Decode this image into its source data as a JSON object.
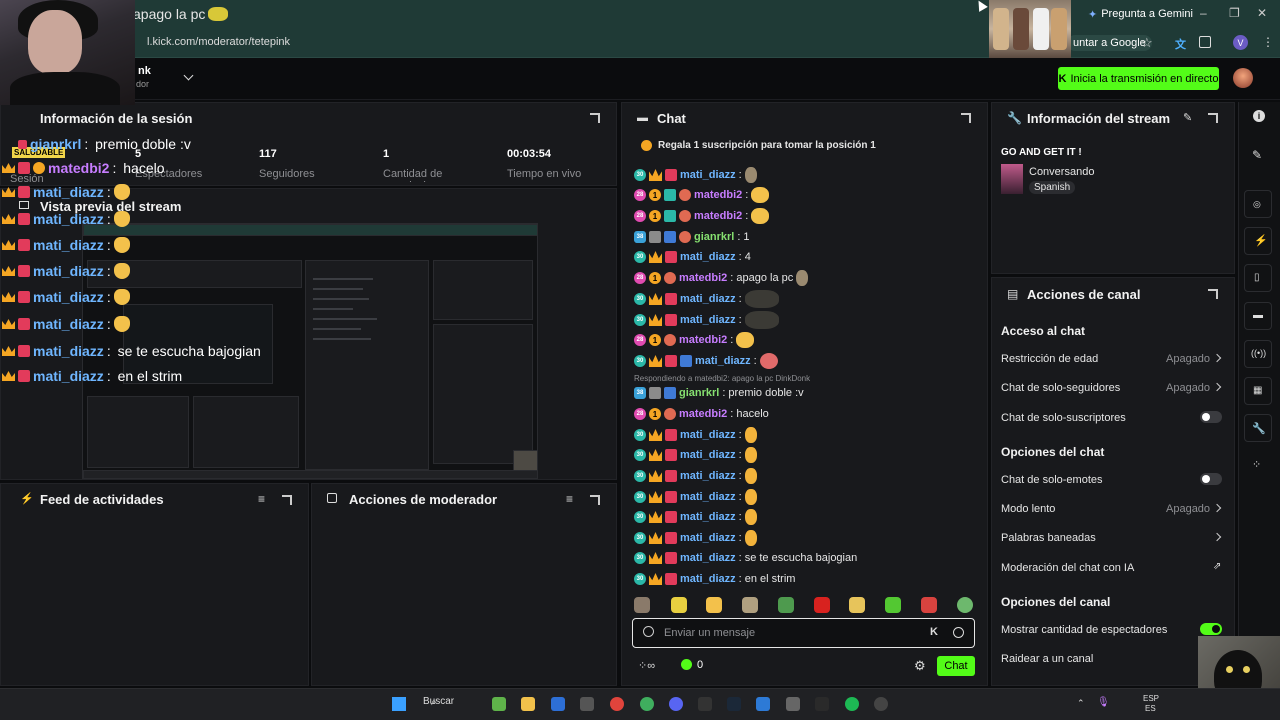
{
  "browser": {
    "tab_title": "apago la pc",
    "url": "l.kick.com/moderator/tetepink",
    "gemini_label": "Pregunta a Gemini",
    "google_btn": "untar a Google",
    "profile_initial": "V"
  },
  "kick": {
    "channel_short": "nk",
    "channel_sub": "dor",
    "live_button": "Inicia la transmisión en directo"
  },
  "session": {
    "title": "Información de la sesión",
    "session_label": "Sesión",
    "stats": [
      {
        "value": "5",
        "label": "Espectadores"
      },
      {
        "value": "117",
        "label": "Seguidores"
      },
      {
        "value": "1",
        "label": "Cantidad de suscripciones"
      },
      {
        "value": "00:03:54",
        "label": "Tiempo en vivo"
      }
    ]
  },
  "preview": {
    "title": "Vista previa del stream"
  },
  "overlay": {
    "badge": "SALUDABLE",
    "lines": [
      {
        "name": "gianrkrl",
        "msg": "premio doble :v",
        "style": "blue"
      },
      {
        "name": "matedbi2",
        "msg": "hacelo",
        "style": "purple"
      },
      {
        "name": "mati_diazz",
        "msg": "",
        "style": "blue"
      },
      {
        "name": "mati_diazz",
        "msg": "",
        "style": "blue"
      },
      {
        "name": "mati_diazz",
        "msg": "",
        "style": "blue"
      },
      {
        "name": "mati_diazz",
        "msg": "",
        "style": "blue"
      },
      {
        "name": "mati_diazz",
        "msg": "",
        "style": "blue"
      },
      {
        "name": "mati_diazz",
        "msg": "",
        "style": "blue"
      },
      {
        "name": "mati_diazz",
        "msg": "se te escucha bajogian",
        "style": "blue"
      },
      {
        "name": "mati_diazz",
        "msg": "en el strim",
        "style": "blue"
      }
    ]
  },
  "activity": {
    "title": "Feed de actividades"
  },
  "mod_actions": {
    "title": "Acciones de moderador"
  },
  "chat": {
    "title": "Chat",
    "pinned": "Regala 1 suscripción para tomar la posición 1",
    "reply_note": "Respondiendo a matedbi2: apago la pc DinkDonk",
    "messages": [
      {
        "name": "mati_diazz",
        "msg": "",
        "color": "blue"
      },
      {
        "name": "matedbi2",
        "msg": "",
        "color": "purple"
      },
      {
        "name": "matedbi2",
        "msg": "",
        "color": "purple"
      },
      {
        "name": "gianrkrl",
        "msg": "1",
        "color": "green"
      },
      {
        "name": "mati_diazz",
        "msg": "4",
        "color": "blue"
      },
      {
        "name": "matedbi2",
        "msg": "apago la pc",
        "color": "purple"
      },
      {
        "name": "mati_diazz",
        "msg": "",
        "color": "blue"
      },
      {
        "name": "mati_diazz",
        "msg": "",
        "color": "blue"
      },
      {
        "name": "matedbi2",
        "msg": "",
        "color": "purple"
      },
      {
        "name": "mati_diazz",
        "msg": "",
        "color": "blue"
      },
      {
        "name": "gianrkrl",
        "msg": "premio doble :v",
        "color": "green"
      },
      {
        "name": "matedbi2",
        "msg": "hacelo",
        "color": "purple"
      },
      {
        "name": "mati_diazz",
        "msg": "",
        "color": "blue"
      },
      {
        "name": "mati_diazz",
        "msg": "",
        "color": "blue"
      },
      {
        "name": "mati_diazz",
        "msg": "",
        "color": "blue"
      },
      {
        "name": "mati_diazz",
        "msg": "",
        "color": "blue"
      },
      {
        "name": "mati_diazz",
        "msg": "",
        "color": "blue"
      },
      {
        "name": "mati_diazz",
        "msg": "",
        "color": "blue"
      },
      {
        "name": "mati_diazz",
        "msg": "se te escucha bajogian",
        "color": "blue"
      },
      {
        "name": "mati_diazz",
        "msg": "en el strim",
        "color": "blue"
      }
    ],
    "input_placeholder": "Enviar un mensaje",
    "points": "0",
    "send_label": "Chat"
  },
  "stream_info": {
    "title": "Información del stream",
    "stream_title": "GO AND GET IT !",
    "category": "Conversando",
    "language": "Spanish"
  },
  "channel_actions": {
    "title": "Acciones de canal",
    "sections": [
      {
        "heading": "Acceso al chat"
      },
      {
        "heading": "Opciones del chat"
      },
      {
        "heading": "Opciones del canal"
      }
    ],
    "rows": {
      "age": {
        "label": "Restricción de edad",
        "value": "Apagado"
      },
      "followers": {
        "label": "Chat de solo-seguidores",
        "value": "Apagado"
      },
      "subs": {
        "label": "Chat de solo-suscriptores"
      },
      "emotes": {
        "label": "Chat de solo-emotes"
      },
      "slow": {
        "label": "Modo lento",
        "value": "Apagado"
      },
      "banned": {
        "label": "Palabras baneadas"
      },
      "ai": {
        "label": "Moderación del chat con IA"
      },
      "viewers": {
        "label": "Mostrar cantidad de espectadores"
      },
      "raid": {
        "label": "Raidear a un canal"
      }
    }
  },
  "taskbar": {
    "search": "Buscar",
    "lang": "ESP",
    "lang2": "ES"
  },
  "colors": {
    "kick_green": "#53fc18",
    "chrome_bg": "#1f3a36",
    "panel_bg": "#18191c"
  }
}
